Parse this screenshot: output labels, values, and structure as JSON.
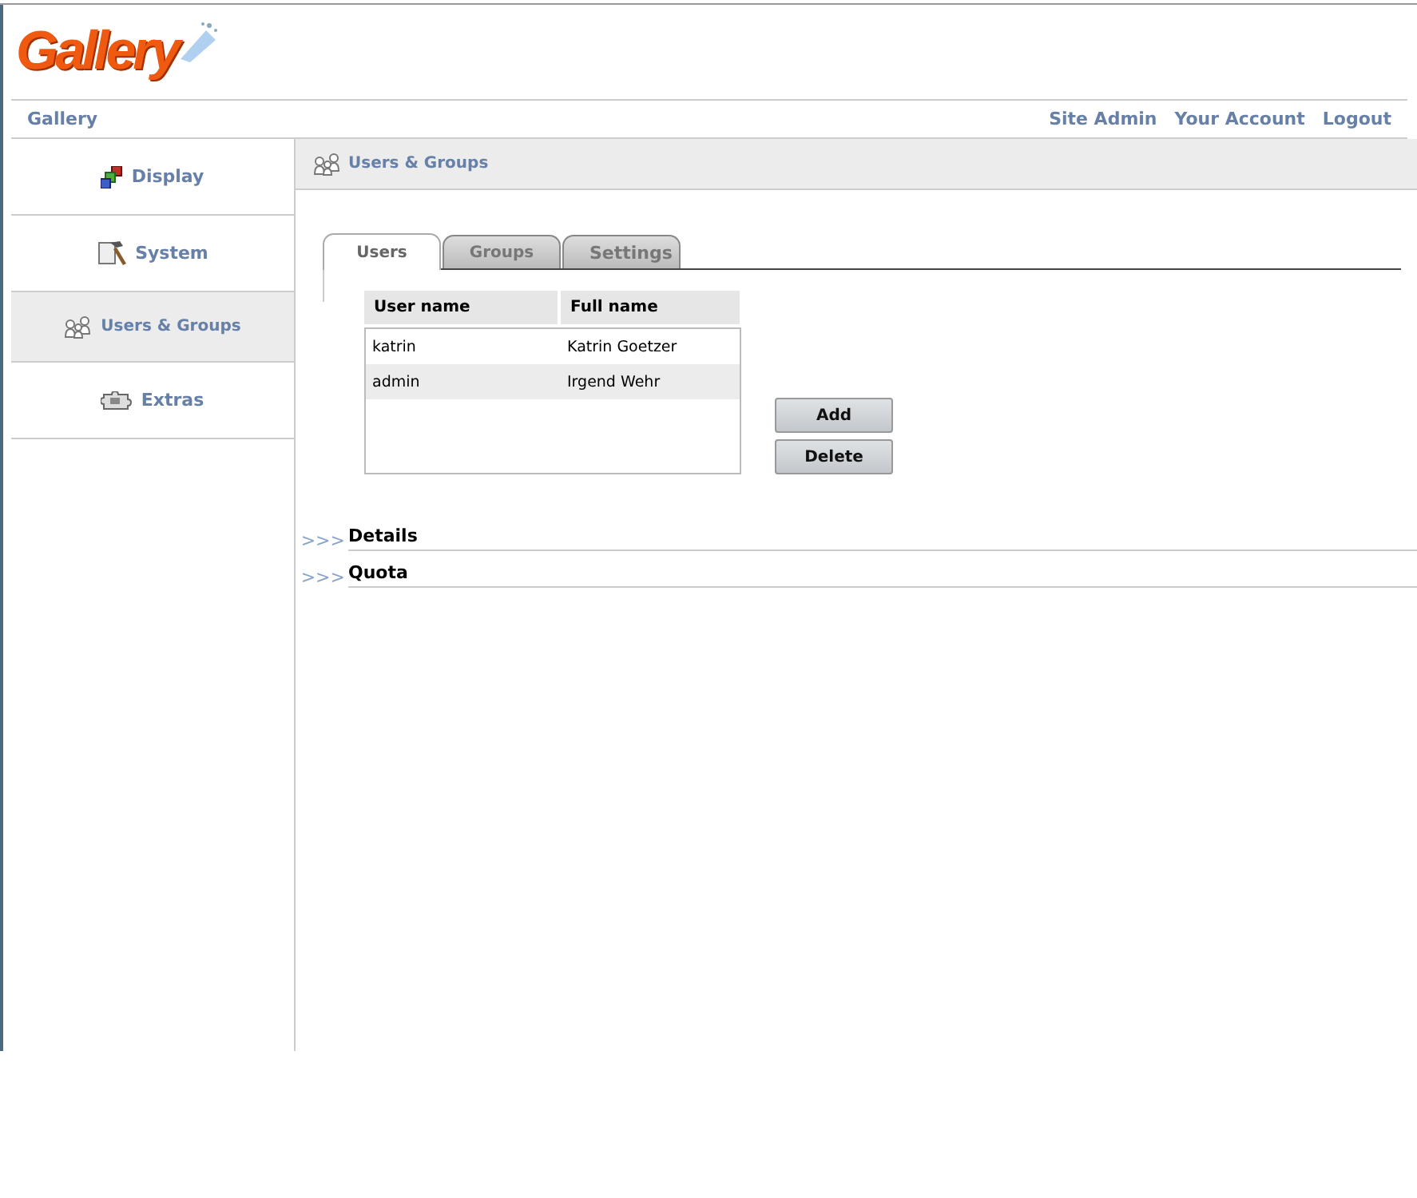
{
  "logo": {
    "text": "Gallery"
  },
  "nav": {
    "breadcrumb": "Gallery",
    "links": [
      "Site Admin",
      "Your Account",
      "Logout"
    ]
  },
  "sidebar": {
    "items": [
      {
        "label": "Display",
        "selected": false
      },
      {
        "label": "System",
        "selected": false
      },
      {
        "label": "Users & Groups",
        "selected": true
      },
      {
        "label": "Extras",
        "selected": false
      }
    ]
  },
  "page_title": "Users & Groups",
  "tabs": [
    {
      "label": "Users",
      "selected": true
    },
    {
      "label": "Groups",
      "selected": false
    },
    {
      "label": "Settings",
      "selected": false
    }
  ],
  "table": {
    "columns": [
      "User name",
      "Full name"
    ],
    "rows": [
      {
        "cells": [
          "katrin",
          "Katrin Goetzer"
        ],
        "selected": false
      },
      {
        "cells": [
          "admin",
          "Irgend Wehr"
        ],
        "selected": true
      }
    ]
  },
  "buttons": [
    "Add",
    "Delete"
  ],
  "sections": [
    {
      "marker": ">>>",
      "title": "Details",
      "expanded": false
    },
    {
      "marker": ">>>",
      "title": "Quota",
      "expanded": false
    }
  ]
}
